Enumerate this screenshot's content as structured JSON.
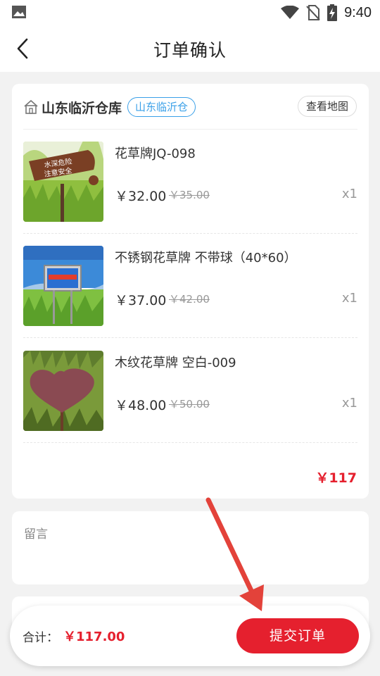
{
  "status_bar": {
    "time": "9:40",
    "icons": [
      "gallery-icon",
      "wifi-icon",
      "no-sim-icon",
      "battery-charging-icon"
    ]
  },
  "header": {
    "title": "订单确认",
    "back_icon": "chevron-left-icon"
  },
  "store": {
    "icon": "house-icon",
    "name": "山东临沂仓库",
    "tag": "山东临沂仓",
    "map_button": "查看地图"
  },
  "products": [
    {
      "name": "花草牌JQ-098",
      "price": "￥32.00",
      "original_price": "￥35.00",
      "quantity": "x1",
      "sign_text": [
        "水深危险",
        "注意安全"
      ]
    },
    {
      "name": "不锈钢花草牌 不带球（40*60）",
      "price": "￥37.00",
      "original_price": "￥42.00",
      "quantity": "x1"
    },
    {
      "name": "木纹花草牌 空白-009",
      "price": "￥48.00",
      "original_price": "￥50.00",
      "quantity": "x1"
    }
  ],
  "subtotal": "￥117",
  "note": {
    "label": "留言"
  },
  "bottom_bar": {
    "total_label": "合计：",
    "total_value": "￥117.00",
    "submit_button": "提交订单"
  },
  "colors": {
    "accent_red": "#e5202e",
    "tag_blue": "#3aa0e8",
    "background": "#f2f2f2"
  }
}
